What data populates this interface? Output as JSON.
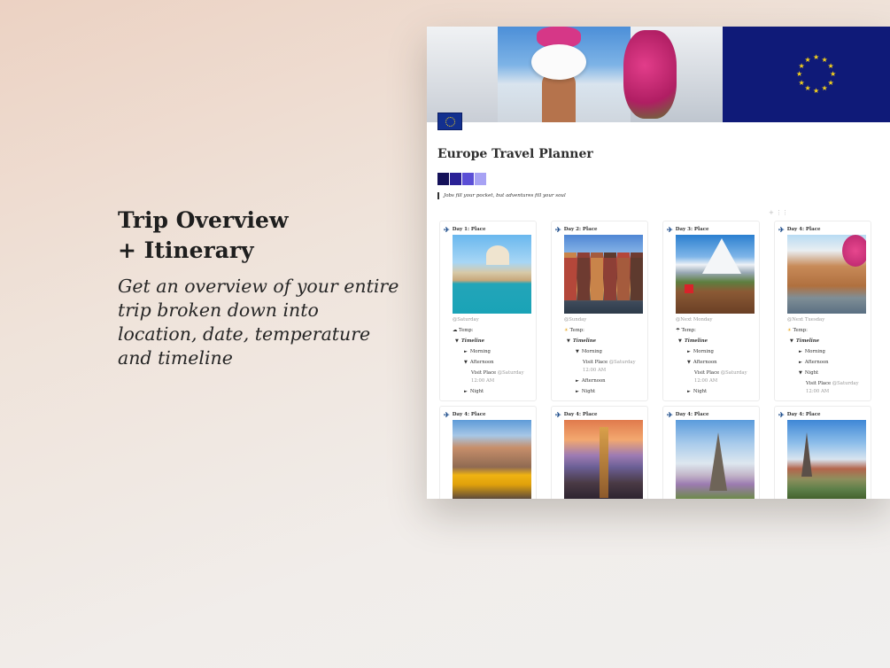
{
  "promo": {
    "title_line1": "Trip Overview",
    "title_line2": "+ Itinerary",
    "description": "Get an overview of your entire trip broken down into location, date, temperature and timeline"
  },
  "page": {
    "title": "Europe Travel Planner",
    "quote": "Jobs fill your pocket, but adventures fill your soul",
    "swatch_colors": [
      "#141159",
      "#2a2196",
      "#5b4fd6",
      "#a7a2f4"
    ],
    "flag_color": "#0f1a78",
    "star_color": "#f6d21b",
    "add_handle": "+ ⋮⋮"
  },
  "cards": [
    {
      "title": "Day 1: Place",
      "date": "@Saturday",
      "temp_icon": "☁",
      "temp_label": "Temp:",
      "timeline_label": "Timeline",
      "items": [
        {
          "arrow": "►",
          "label": "Morning"
        },
        {
          "arrow": "▼",
          "label": "Afternoon"
        },
        {
          "visit": "Visit Place",
          "visit_date": "@Saturday",
          "visit_time": "12:00 AM"
        },
        {
          "arrow": "►",
          "label": "Night"
        }
      ]
    },
    {
      "title": "Day 2: Place",
      "date": "@Sunday",
      "temp_icon": "☀",
      "temp_label": "Temp:",
      "timeline_label": "Timeline",
      "items": [
        {
          "arrow": "▼",
          "label": "Morning"
        },
        {
          "visit": "Visit Place",
          "visit_date": "@Saturday",
          "visit_time": "12:00 AM"
        },
        {
          "arrow": "►",
          "label": "Afternoon"
        },
        {
          "arrow": "►",
          "label": "Night"
        }
      ]
    },
    {
      "title": "Day 3: Place",
      "date": "@Next Monday",
      "temp_icon": "☂",
      "temp_label": "Temp:",
      "timeline_label": "Timeline",
      "items": [
        {
          "arrow": "►",
          "label": "Morning"
        },
        {
          "arrow": "▼",
          "label": "Afternoon"
        },
        {
          "visit": "Visit Place",
          "visit_date": "@Saturday",
          "visit_time": "12:00 AM"
        },
        {
          "arrow": "►",
          "label": "Night"
        }
      ]
    },
    {
      "title": "Day 4: Place",
      "date": "@Next Tuesday",
      "temp_icon": "☀",
      "temp_label": "Temp:",
      "timeline_label": "Timeline",
      "items": [
        {
          "arrow": "►",
          "label": "Morning"
        },
        {
          "arrow": "►",
          "label": "Afternoon"
        },
        {
          "arrow": "▼",
          "label": "Night"
        },
        {
          "visit": "Visit Place",
          "visit_date": "@Saturday",
          "visit_time": "12:00 AM"
        }
      ]
    }
  ],
  "row2_cards": [
    {
      "title": "Day 4: Place"
    },
    {
      "title": "Day 4: Place"
    },
    {
      "title": "Day 4: Place"
    },
    {
      "title": "Day 4: Place"
    }
  ]
}
